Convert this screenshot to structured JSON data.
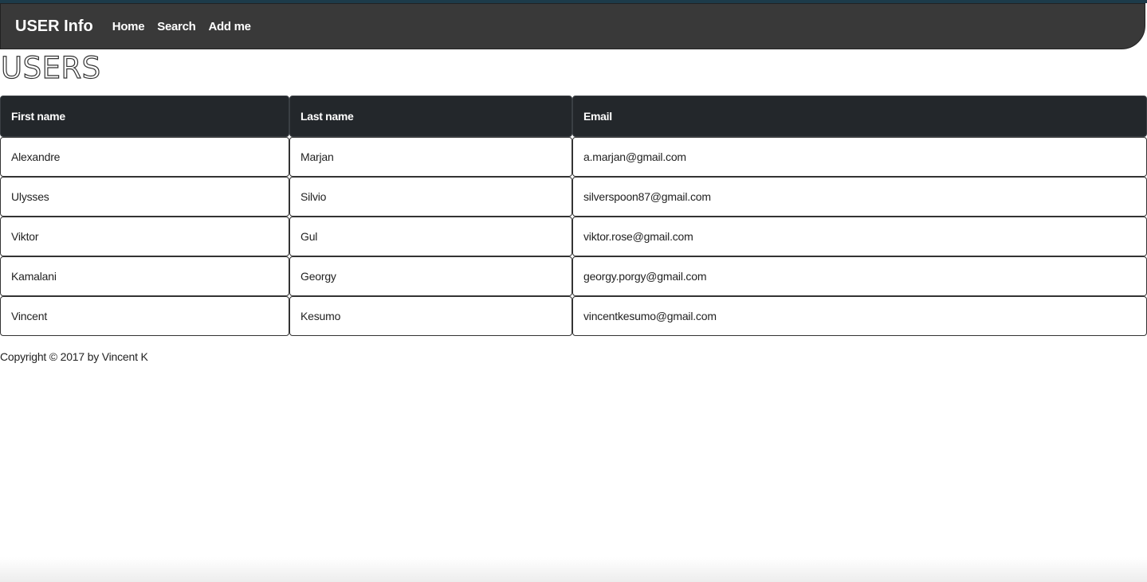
{
  "navbar": {
    "brand": "USER Info",
    "links": [
      "Home",
      "Search",
      "Add me"
    ]
  },
  "page": {
    "title": "USERS"
  },
  "table": {
    "headers": [
      "First name",
      "Last name",
      "Email"
    ],
    "rows": [
      [
        "Alexandre",
        "Marjan",
        "a.marjan@gmail.com"
      ],
      [
        "Ulysses",
        "Silvio",
        "silverspoon87@gmail.com"
      ],
      [
        "Viktor",
        "Gul",
        "viktor.rose@gmail.com"
      ],
      [
        "Kamalani",
        "Georgy",
        "georgy.porgy@gmail.com"
      ],
      [
        "Vincent",
        "Kesumo",
        "vincentkesumo@gmail.com"
      ]
    ]
  },
  "footer": {
    "text": "Copyright © 2017 by Vincent K"
  },
  "colors": {
    "navbar_bg": "#393939",
    "table_header_bg": "#23272b",
    "top_strip": "#1d3b4a"
  }
}
